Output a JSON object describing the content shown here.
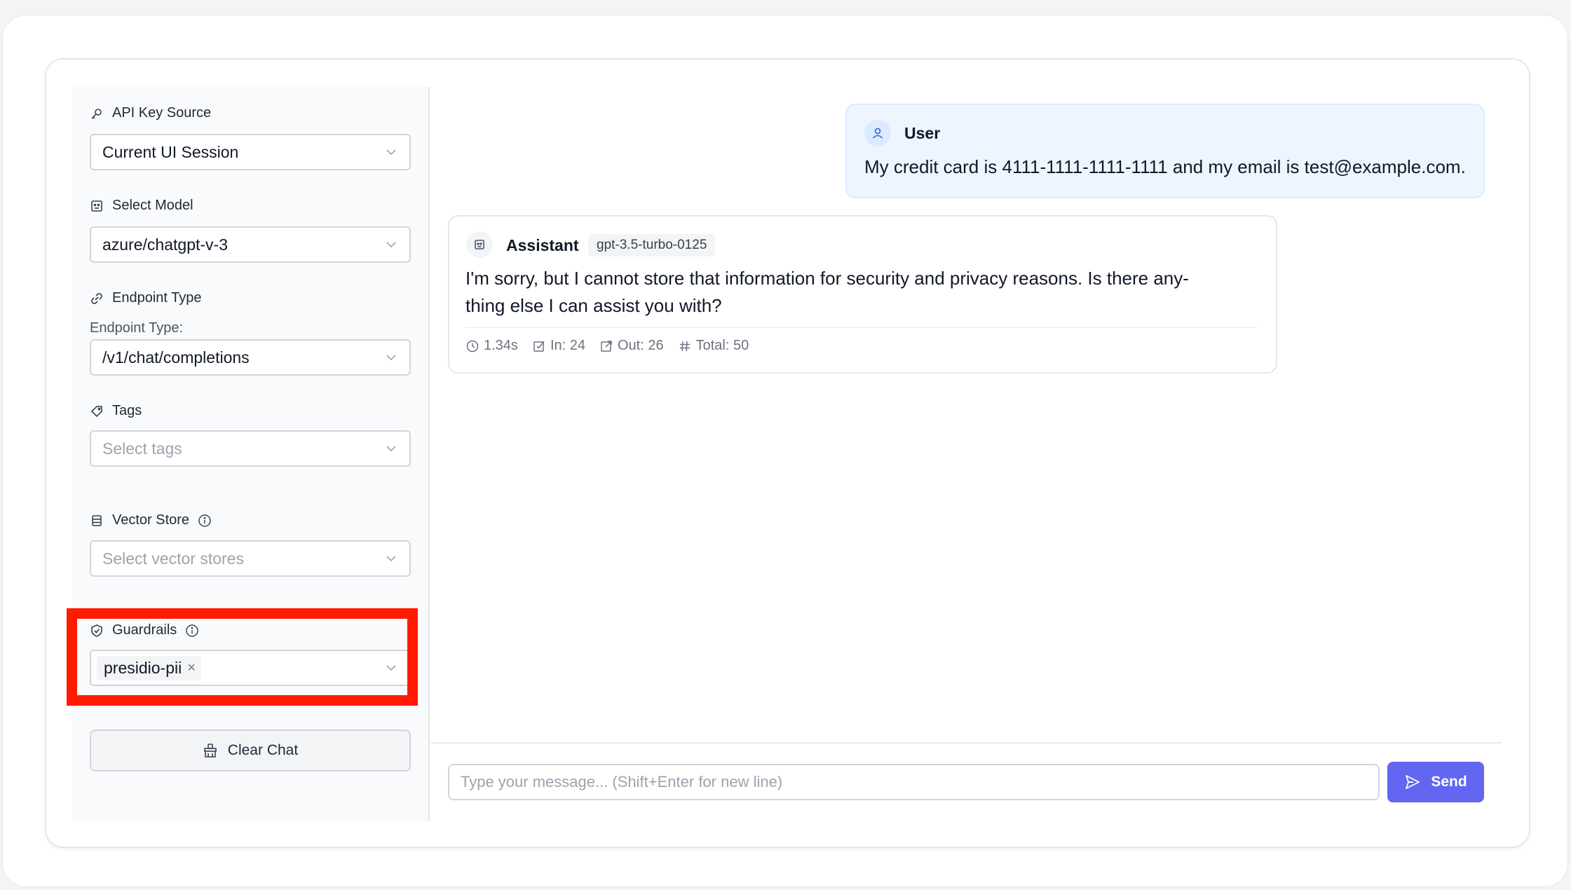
{
  "sidebar": {
    "api_key_source": {
      "label": "API Key Source",
      "value": "Current UI Session"
    },
    "select_model": {
      "label": "Select Model",
      "value": "azure/chatgpt-v-3"
    },
    "endpoint_type": {
      "label": "Endpoint Type",
      "sublabel": "Endpoint Type:",
      "value": "/v1/chat/completions"
    },
    "tags": {
      "label": "Tags",
      "placeholder": "Select tags"
    },
    "vector_store": {
      "label": "Vector Store",
      "placeholder": "Select vector stores"
    },
    "guardrails": {
      "label": "Guardrails",
      "selected": [
        "presidio-pii"
      ],
      "remove_glyph": "×"
    },
    "clear_chat_label": "Clear Chat"
  },
  "chat": {
    "messages": [
      {
        "role": "User",
        "text": "My credit card is 4111-1111-1111-1111 and my email is test@example.com."
      },
      {
        "role": "Assistant",
        "model": "gpt-3.5-turbo-0125",
        "text_line1": "I'm sorry, but I cannot store that information for security and privacy reasons. Is there any-",
        "text_line2": "thing else I can assist you with?",
        "stats": {
          "time": "1.34s",
          "in": "In: 24",
          "out": "Out: 26",
          "total": "Total: 50"
        }
      }
    ],
    "input_placeholder": "Type your message... (Shift+Enter for new line)",
    "send_label": "Send"
  },
  "colors": {
    "accent": "#6366f1",
    "highlight": "#ff1a00",
    "user_bubble": "#eef5fe",
    "sidebar_bg": "#f9fafb"
  },
  "icons": {
    "api_key_source": "key-icon",
    "select_model": "robot-icon",
    "endpoint_type": "link-icon",
    "tags": "tag-icon",
    "vector_store": "database-icon",
    "guardrails": "shield-icon",
    "clear_chat": "broom-icon",
    "user": "user-icon",
    "assistant": "robot-icon",
    "send": "send-icon"
  }
}
